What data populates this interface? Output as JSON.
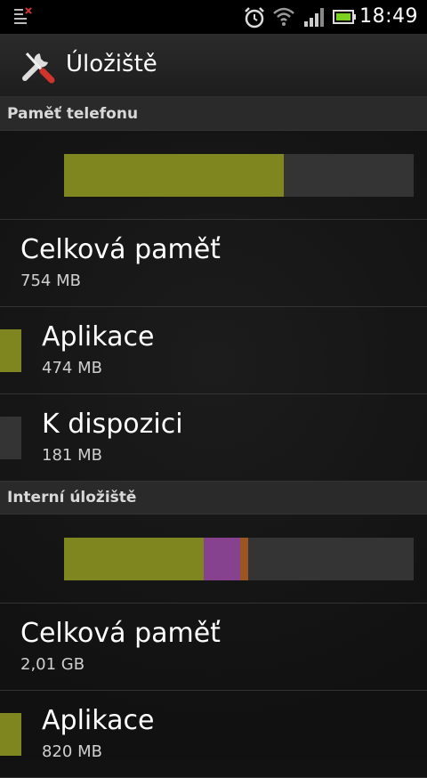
{
  "status_bar": {
    "time": "18:49",
    "icons": [
      "notification-icon",
      "alarm-icon",
      "wifi-icon",
      "signal-icon",
      "battery-icon"
    ]
  },
  "action_bar": {
    "title": "Úložiště",
    "icon": "tools-icon"
  },
  "colors": {
    "apps": "#7f861f",
    "free": "#343434",
    "media": "#86418f",
    "other": "#9a5523",
    "background": "#121212"
  },
  "sections": [
    {
      "header": "Paměť telefonu",
      "usage_bar": [
        {
          "segment": "apps",
          "fraction": 0.629
        },
        {
          "segment": "free",
          "fraction": 0.371
        }
      ],
      "total": {
        "label": "Celková paměť",
        "value": "754 MB"
      },
      "items": [
        {
          "label": "Aplikace",
          "value": "474 MB",
          "color": "apps"
        },
        {
          "label": "K dispozici",
          "value": "181 MB",
          "color": "free"
        }
      ]
    },
    {
      "header": "Interní úložiště",
      "usage_bar": [
        {
          "segment": "apps",
          "fraction": 0.4
        },
        {
          "segment": "media",
          "fraction": 0.104
        },
        {
          "segment": "other",
          "fraction": 0.023
        },
        {
          "segment": "free",
          "fraction": 0.473
        }
      ],
      "total": {
        "label": "Celková paměť",
        "value": "2,01 GB"
      },
      "items": [
        {
          "label": "Aplikace",
          "value": "820 MB",
          "color": "apps"
        }
      ]
    }
  ]
}
